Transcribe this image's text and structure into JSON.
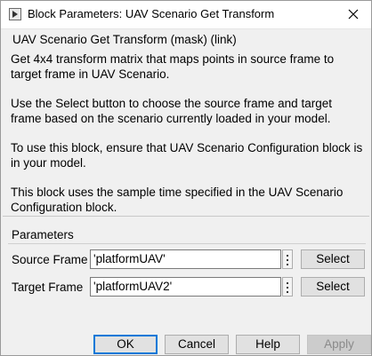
{
  "window": {
    "title": "Block Parameters: UAV Scenario Get Transform"
  },
  "header": {
    "title": "UAV Scenario Get Transform (mask) (link)",
    "paragraphs": [
      "Get 4x4 transform matrix that maps points in source frame to target frame in UAV Scenario.",
      "Use the Select button to choose the source frame and target frame based on the scenario currently loaded in your model.",
      "To use this block, ensure that UAV Scenario Configuration block is in your model.",
      "This block uses the sample time specified in the UAV Scenario Configuration block."
    ]
  },
  "parameters": {
    "group_title": "Parameters",
    "source_frame": {
      "label": "Source Frame",
      "value": "'platformUAV'",
      "select_label": "Select"
    },
    "target_frame": {
      "label": "Target Frame",
      "value": "'platformUAV2'",
      "select_label": "Select"
    }
  },
  "buttons": {
    "ok": "OK",
    "cancel": "Cancel",
    "help": "Help",
    "apply": "Apply"
  },
  "colors": {
    "focus_border": "#0078d7",
    "dialog_background": "#f0f0f0"
  }
}
